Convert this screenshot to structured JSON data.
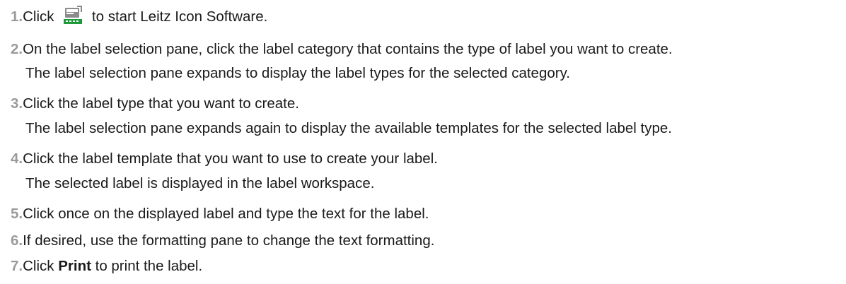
{
  "steps": [
    {
      "number": "1.",
      "before_icon": "Click ",
      "icon": "leitz-icon-software-icon",
      "after_icon": " to start Leitz Icon Software."
    },
    {
      "number": "2.",
      "text": "On the label selection pane, click the label category that contains the type of label you want to create.",
      "note": "The label selection pane expands to display the label types for the selected category."
    },
    {
      "number": "3.",
      "text": "Click the label type that you want to create.",
      "note": "The label selection pane expands again to display the available templates for the selected label type."
    },
    {
      "number": "4.",
      "text": "Click the label template that you want to use to create your label.",
      "note": "The selected label is displayed in the label workspace."
    },
    {
      "number": "5.",
      "text": "Click once on the displayed label and type the text for the label."
    },
    {
      "number": "6.",
      "text": "If desired, use the formatting pane to change the text formatting."
    },
    {
      "number": "7.",
      "before_bold": "Click ",
      "bold": "Print",
      "after_bold": " to print the label."
    }
  ],
  "colors": {
    "number": "#9a9a9a",
    "text": "#1a1a1a",
    "icon_green": "#1f9a3a",
    "icon_gray": "#8c8c8c"
  }
}
